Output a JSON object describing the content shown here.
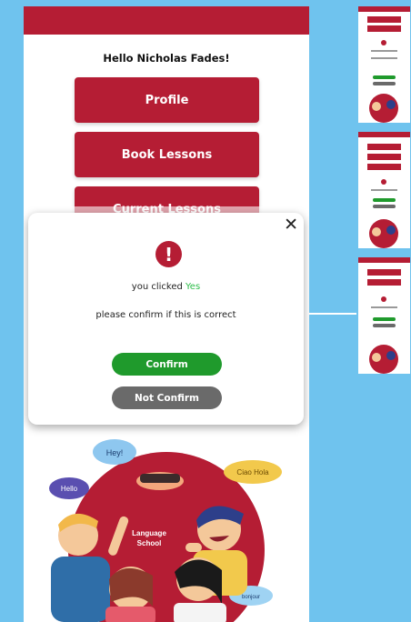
{
  "greeting": "Hello Nicholas Fades!",
  "menu": {
    "profile": "Profile",
    "book_lessons": "Book Lessons",
    "current_lessons": "Current Lessons"
  },
  "modal": {
    "close_symbol": "✕",
    "alert_symbol": "!",
    "clicked_prefix": "you clicked",
    "clicked_value": "Yes",
    "message": "please confirm if this is correct",
    "confirm_label": "Confirm",
    "not_confirm_label": "Not Confirm"
  },
  "illustration": {
    "bubble_hey": "Hey!",
    "bubble_hello": "Hello",
    "bubble_top_right": "Ciao Hola",
    "bubble_bottom_right": "bonjour",
    "sign_text_1": "Language",
    "sign_text_2": "School"
  },
  "colors": {
    "brand_red": "#b51d34",
    "confirm_green": "#1f9a2c",
    "not_confirm_gray": "#6a6a6a",
    "yes_green": "#2dbd4a",
    "background_blue": "#6fc3ee"
  }
}
